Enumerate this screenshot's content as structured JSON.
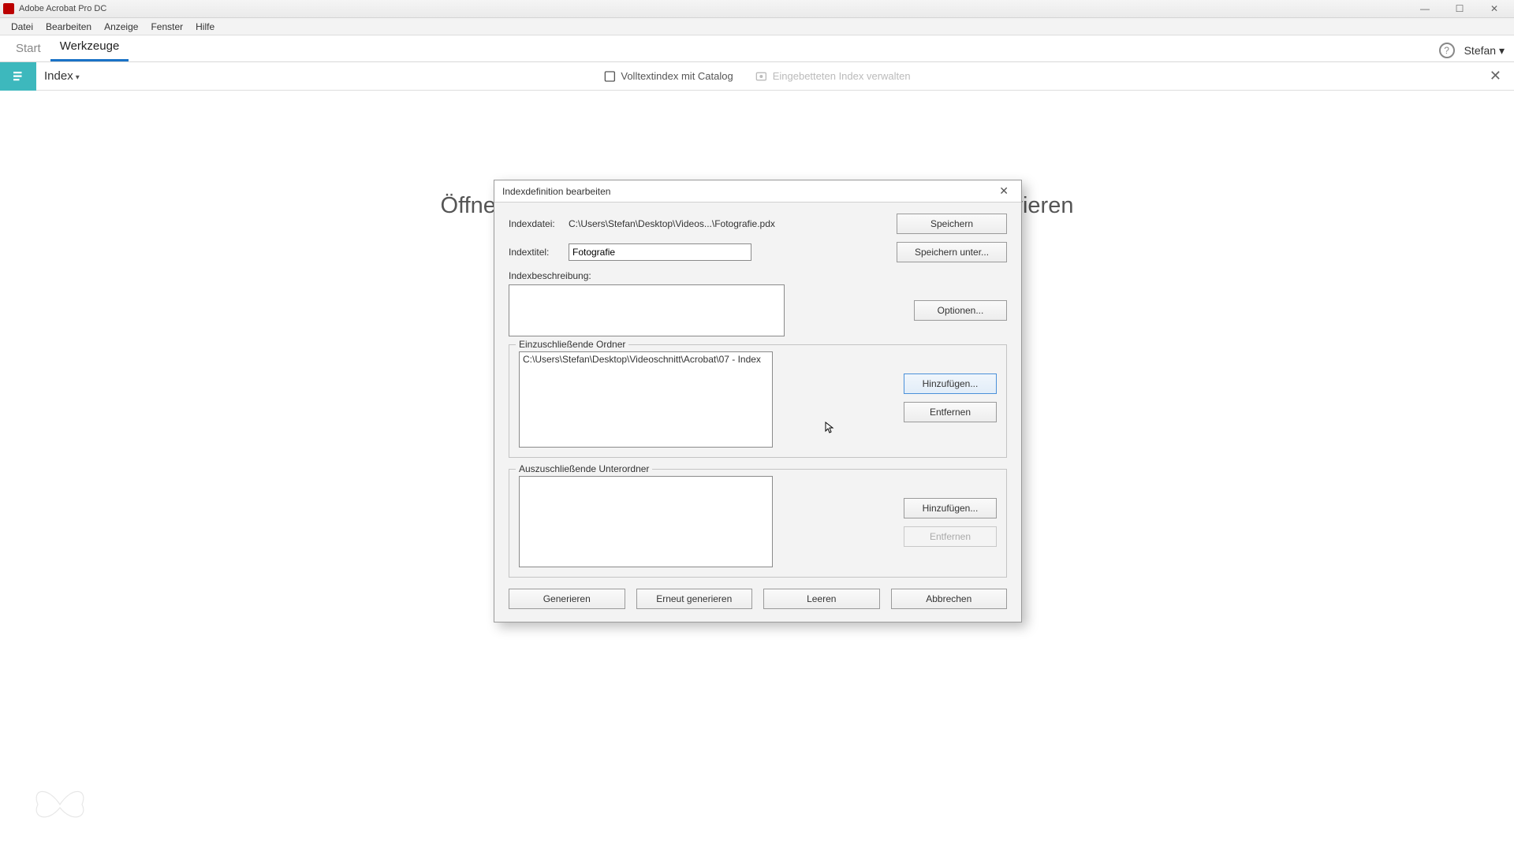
{
  "app": {
    "title": "Adobe Acrobat Pro DC"
  },
  "menu": {
    "items": [
      "Datei",
      "Bearbeiten",
      "Anzeige",
      "Fenster",
      "Hilfe"
    ]
  },
  "tabs": {
    "start": "Start",
    "tools": "Werkzeuge"
  },
  "tabright": {
    "user": "Stefan"
  },
  "toolsub": {
    "label": "Index",
    "fulltext": "Volltextindex mit Catalog",
    "manage": "Eingebetteten Index verwalten"
  },
  "bgtext": "Öffnen Sie eine Datei, um die \"index\"-Werkzeuge zu aktivieren",
  "dialog": {
    "title": "Indexdefinition bearbeiten",
    "labels": {
      "indexdatei": "Indexdatei:",
      "indextitel": "Indextitel:",
      "indexbeschreibung": "Indexbeschreibung:"
    },
    "values": {
      "indexdatei_path": "C:\\Users\\Stefan\\Desktop\\Videos...\\Fotografie.pdx",
      "indextitel": "Fotografie",
      "indexbeschreibung": ""
    },
    "buttons": {
      "speichern": "Speichern",
      "speichern_unter": "Speichern unter...",
      "optionen": "Optionen...",
      "hinzufuegen": "Hinzufügen...",
      "entfernen": "Entfernen",
      "generieren": "Generieren",
      "erneut_generieren": "Erneut generieren",
      "leeren": "Leeren",
      "abbrechen": "Abbrechen"
    },
    "include": {
      "legend": "Einzuschließende Ordner",
      "items": [
        "C:\\Users\\Stefan\\Desktop\\Videoschnitt\\Acrobat\\07 - Index"
      ]
    },
    "exclude": {
      "legend": "Auszuschließende Unterordner",
      "items": []
    }
  }
}
